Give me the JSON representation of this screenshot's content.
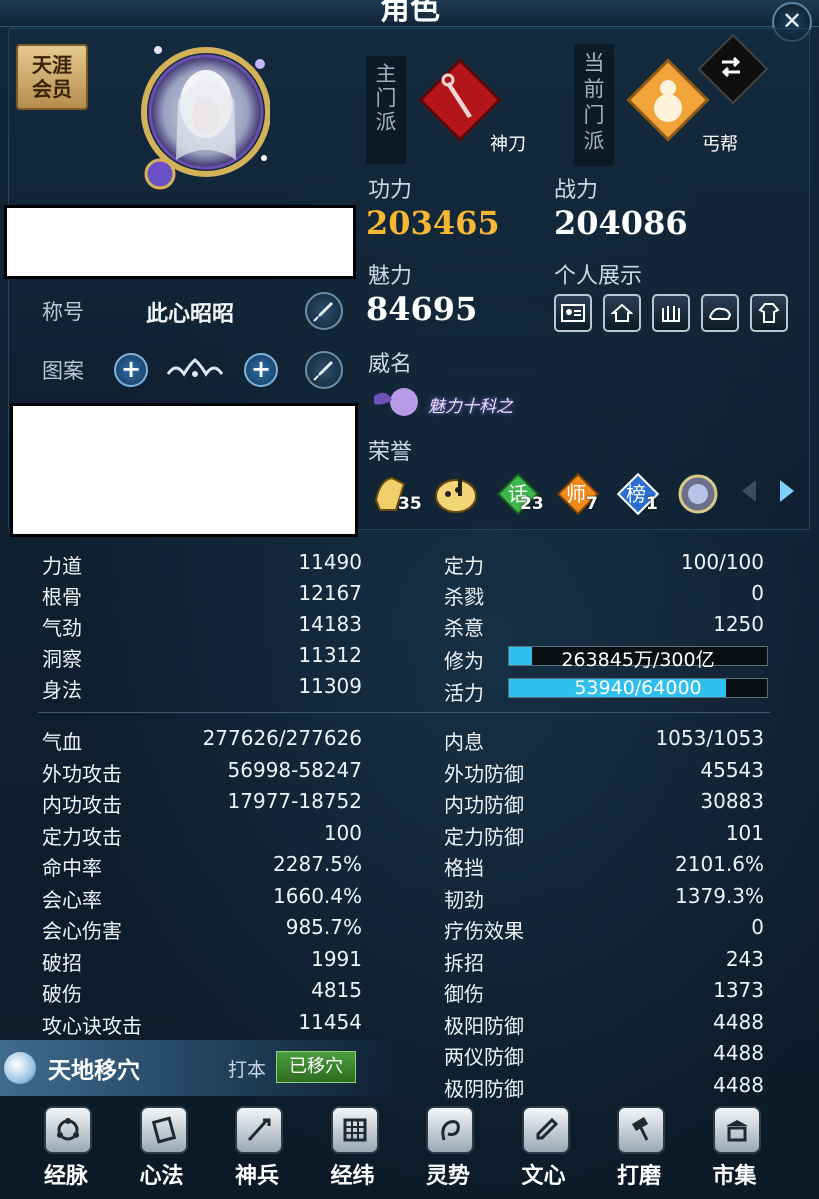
{
  "window": {
    "title": "角色",
    "close_label": "✕"
  },
  "profile": {
    "vip_line1": "天涯",
    "vip_line2": "会员",
    "title_label": "称号",
    "title_value": "此心昭昭",
    "pattern_label": "图案"
  },
  "sect": {
    "main_label_chars": [
      "主",
      "门",
      "派"
    ],
    "main_name": "神刀",
    "current_label_chars": [
      "当",
      "前",
      "门",
      "派"
    ],
    "current_name": "丐帮",
    "main_color": "#c0191c",
    "current_color": "#f2a83a"
  },
  "stats": {
    "gongli_label": "功力",
    "gongli_value": "203465",
    "zhanli_label": "战力",
    "zhanli_value": "204086",
    "meili_label": "魅力",
    "meili_value": "84695",
    "show_label": "个人展示",
    "weiming_label": "威名",
    "weiming_badge": "魅力十科之",
    "honor_label": "荣誉"
  },
  "honors": [
    {
      "icon": "cheer-hand-icon",
      "count": "35"
    },
    {
      "icon": "palette-icon",
      "count": ""
    },
    {
      "icon": "diamond-green-icon",
      "text": "话",
      "count": "23"
    },
    {
      "icon": "diamond-orange-icon",
      "text": "师",
      "count": "7"
    },
    {
      "icon": "diamond-blue-icon",
      "text": "榜",
      "count": "1"
    },
    {
      "icon": "medal-icon",
      "count": ""
    }
  ],
  "base_attrs_left": [
    {
      "label": "力道",
      "value": "11490"
    },
    {
      "label": "根骨",
      "value": "12167"
    },
    {
      "label": "气劲",
      "value": "14183"
    },
    {
      "label": "洞察",
      "value": "11312"
    },
    {
      "label": "身法",
      "value": "11309"
    }
  ],
  "base_attrs_right": [
    {
      "label": "定力",
      "value": "100/100"
    },
    {
      "label": "杀戮",
      "value": "0"
    },
    {
      "label": "杀意",
      "value": "1250"
    }
  ],
  "progress": [
    {
      "label": "修为",
      "text": "263845万/300亿",
      "fraction": 0.088
    },
    {
      "label": "活力",
      "text": "53940/64000",
      "fraction": 0.843
    }
  ],
  "combat_left": [
    {
      "label": "气血",
      "value": "277626/277626"
    },
    {
      "label": "外功攻击",
      "value": "56998-58247"
    },
    {
      "label": "内功攻击",
      "value": "17977-18752"
    },
    {
      "label": "定力攻击",
      "value": "100"
    },
    {
      "label": "命中率",
      "value": "2287.5%"
    },
    {
      "label": "会心率",
      "value": "1660.4%"
    },
    {
      "label": "会心伤害",
      "value": "985.7%"
    },
    {
      "label": "破招",
      "value": "1991"
    },
    {
      "label": "破伤",
      "value": "4815"
    },
    {
      "label": "攻心诀攻击",
      "value": "11454"
    }
  ],
  "combat_right": [
    {
      "label": "内息",
      "value": "1053/1053"
    },
    {
      "label": "外功防御",
      "value": "45543"
    },
    {
      "label": "内功防御",
      "value": "30883"
    },
    {
      "label": "定力防御",
      "value": "101"
    },
    {
      "label": "格挡",
      "value": "2101.6%"
    },
    {
      "label": "韧劲",
      "value": "1379.3%"
    },
    {
      "label": "疗伤效果",
      "value": "0"
    },
    {
      "label": "拆招",
      "value": "243"
    },
    {
      "label": "御伤",
      "value": "1373"
    },
    {
      "label": "极阳防御",
      "value": "4488"
    },
    {
      "label": "两仪防御",
      "value": "4488"
    },
    {
      "label": "极阴防御",
      "value": "4488"
    }
  ],
  "migrate": {
    "title": "天地移穴",
    "sub": "打本",
    "button": "已移穴"
  },
  "nav": [
    {
      "label": "经脉",
      "icon": "meridian-icon"
    },
    {
      "label": "心法",
      "icon": "book-icon"
    },
    {
      "label": "神兵",
      "icon": "weapon-icon"
    },
    {
      "label": "经纬",
      "icon": "grid-icon"
    },
    {
      "label": "灵势",
      "icon": "spirit-icon"
    },
    {
      "label": "文心",
      "icon": "writing-icon"
    },
    {
      "label": "打磨",
      "icon": "hammer-icon"
    },
    {
      "label": "市集",
      "icon": "market-icon"
    }
  ]
}
